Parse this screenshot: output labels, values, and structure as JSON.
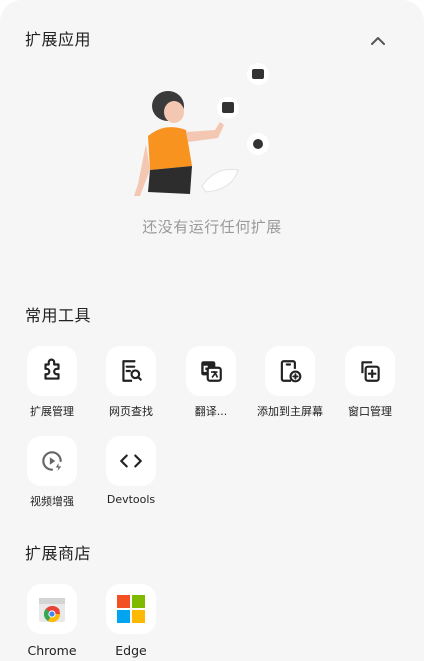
{
  "extensions": {
    "title": "扩展应用",
    "empty_text": "还没有运行任何扩展"
  },
  "tools": {
    "title": "常用工具",
    "items": [
      {
        "label": "扩展管理",
        "icon": "puzzle-icon"
      },
      {
        "label": "网页查找",
        "icon": "find-in-page-icon"
      },
      {
        "label": "翻译...",
        "icon": "translate-icon"
      },
      {
        "label": "添加到主屏幕",
        "icon": "add-to-home-icon"
      },
      {
        "label": "窗口管理",
        "icon": "window-add-icon"
      },
      {
        "label": "视频增强",
        "icon": "video-boost-icon"
      },
      {
        "label": "Devtools",
        "icon": "code-icon"
      }
    ]
  },
  "store": {
    "title": "扩展商店",
    "items": [
      {
        "label": "Chrome",
        "icon": "chrome-store-icon"
      },
      {
        "label": "Edge",
        "icon": "edge-store-icon"
      }
    ]
  },
  "colors": {
    "accent_orange": "#f7931e",
    "background": "#f6f6f6",
    "card": "#ffffff"
  }
}
